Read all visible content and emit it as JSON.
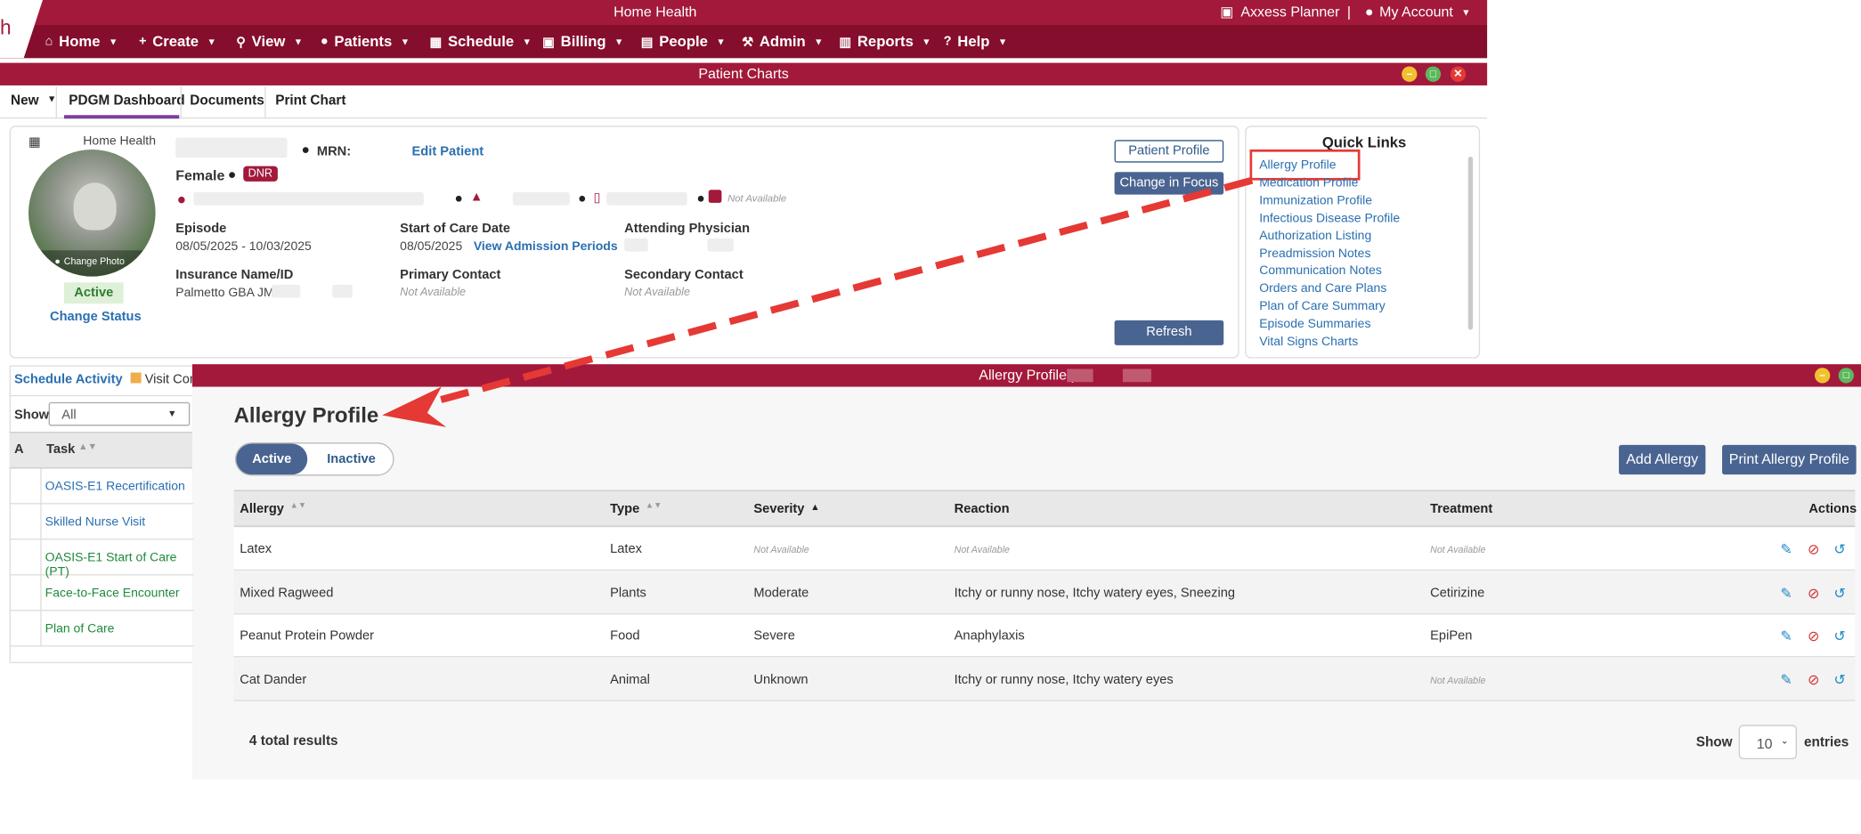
{
  "header": {
    "logo_letter": "h",
    "title": "Home Health",
    "planner": "Axxess Planner",
    "separator": "|",
    "account": "My Account"
  },
  "nav": [
    {
      "label": "Home",
      "icon": "home-icon"
    },
    {
      "label": "Create",
      "icon": "plus-icon"
    },
    {
      "label": "View",
      "icon": "search-icon"
    },
    {
      "label": "Patients",
      "icon": "user-icon"
    },
    {
      "label": "Schedule",
      "icon": "calendar-icon"
    },
    {
      "label": "Billing",
      "icon": "money-icon"
    },
    {
      "label": "People",
      "icon": "id-card-icon"
    },
    {
      "label": "Admin",
      "icon": "wrench-icon"
    },
    {
      "label": "Reports",
      "icon": "chart-icon"
    },
    {
      "label": "Help",
      "icon": "help-icon"
    }
  ],
  "patient_charts": {
    "title": "Patient Charts"
  },
  "tabs": {
    "new": "New",
    "pdgm": "PDGM Dashboard",
    "documents": "Documents",
    "print_chart": "Print Chart"
  },
  "patient": {
    "branch": "Home Health",
    "mrn_label": "MRN:",
    "edit": "Edit Patient",
    "gender": "Female",
    "dnr": "DNR",
    "not_available": "Not Available",
    "change_photo": "Change Photo",
    "status": "Active",
    "change_status": "Change Status",
    "episode_label": "Episode",
    "episode": "08/05/2025 - 10/03/2025",
    "soc_label": "Start of Care Date",
    "soc": "08/05/2025",
    "admission_link": "View Admission Periods",
    "physician_label": "Attending Physician",
    "insurance_label": "Insurance Name/ID",
    "insurance": "Palmetto GBA JM/",
    "primary_label": "Primary Contact",
    "primary": "Not Available",
    "secondary_label": "Secondary Contact",
    "secondary": "Not Available",
    "profile_btn": "Patient Profile",
    "focus_btn": "Change in Focus",
    "refresh_btn": "Refresh"
  },
  "quick_links": {
    "title": "Quick Links",
    "items": [
      "Allergy Profile",
      "Medication Profile",
      "Immunization Profile",
      "Infectious Disease Profile",
      "Authorization Listing",
      "Preadmission Notes",
      "Communication Notes",
      "Orders and Care Plans",
      "Plan of Care Summary",
      "Episode Summaries",
      "Vital Signs Charts"
    ]
  },
  "schedule": {
    "tab1": "Schedule Activity",
    "tab2": "Visit Com",
    "show_label": "Show",
    "show_value": "All",
    "col_a": "A",
    "col_task": "Task",
    "tasks": [
      {
        "name": "OASIS-E1 Recertification",
        "color": "#2a6fb0"
      },
      {
        "name": "Skilled Nurse Visit",
        "color": "#2a6fb0"
      },
      {
        "name": "OASIS-E1 Start of Care (PT)",
        "color": "#1e8a3a"
      },
      {
        "name": "Face-to-Face Encounter",
        "color": "#1e8a3a"
      },
      {
        "name": "Plan of Care",
        "color": "#1e8a3a"
      }
    ]
  },
  "allergy": {
    "window_title": "Allergy Profile |",
    "heading": "Allergy Profile",
    "toggle_active": "Active",
    "toggle_inactive": "Inactive",
    "add_btn": "Add Allergy",
    "print_btn": "Print Allergy Profile",
    "columns": {
      "allergy": "Allergy",
      "type": "Type",
      "severity": "Severity",
      "reaction": "Reaction",
      "treatment": "Treatment",
      "actions": "Actions"
    },
    "rows": [
      {
        "allergy": "Latex",
        "type": "Latex",
        "severity": "Not Available",
        "reaction": "Not Available",
        "treatment": "Not Available"
      },
      {
        "allergy": "Mixed Ragweed",
        "type": "Plants",
        "severity": "Moderate",
        "reaction": "Itchy or runny nose, Itchy watery eyes, Sneezing",
        "treatment": "Cetirizine"
      },
      {
        "allergy": "Peanut Protein Powder",
        "type": "Food",
        "severity": "Severe",
        "reaction": "Anaphylaxis",
        "treatment": "EpiPen"
      },
      {
        "allergy": "Cat Dander",
        "type": "Animal",
        "severity": "Unknown",
        "reaction": "Itchy or runny nose, Itchy watery eyes",
        "treatment": "Not Available"
      }
    ],
    "total": "4 total results",
    "show_label": "Show",
    "entries_value": "10",
    "entries_label": "entries"
  },
  "colors": {
    "brand": "#a3193b",
    "nav": "#840e2c",
    "button": "#4a6491",
    "annotation": "#e53935"
  }
}
